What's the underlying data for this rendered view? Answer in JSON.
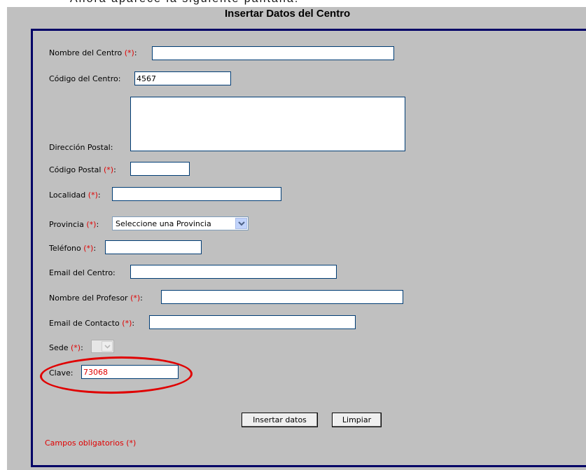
{
  "intro_text": "Ahora aparece la siguiente pantalla:",
  "form": {
    "title": "Insertar Datos del Centro",
    "required_marker": "(*)",
    "fields": {
      "nombre_centro": {
        "label": "Nombre del Centro",
        "value": ""
      },
      "codigo_centro": {
        "label": "Código del Centro:",
        "value": "4567"
      },
      "direccion_postal": {
        "label": "Dirección Postal:",
        "value": ""
      },
      "codigo_postal": {
        "label": "Código Postal",
        "value": ""
      },
      "localidad": {
        "label": "Localidad",
        "value": ""
      },
      "provincia": {
        "label": "Provincia",
        "selected": "Seleccione una Provincia"
      },
      "telefono": {
        "label": "Teléfono",
        "value": ""
      },
      "email_centro": {
        "label": "Email del Centro:",
        "value": ""
      },
      "nombre_profesor": {
        "label": "Nombre del Profesor",
        "value": ""
      },
      "email_contacto": {
        "label": "Email de Contacto",
        "value": ""
      },
      "sede": {
        "label": "Sede",
        "selected": ""
      },
      "clave": {
        "label": "Clave:",
        "value": "73068"
      }
    },
    "buttons": {
      "insert": "Insertar datos",
      "clear": "Limpiar"
    },
    "required_note": "Campos obligatorios (*)"
  },
  "colors": {
    "panel_bg": "#c0c0c0",
    "frame": "#000066",
    "required": "#e00000",
    "highlight_circle": "#e00000"
  }
}
